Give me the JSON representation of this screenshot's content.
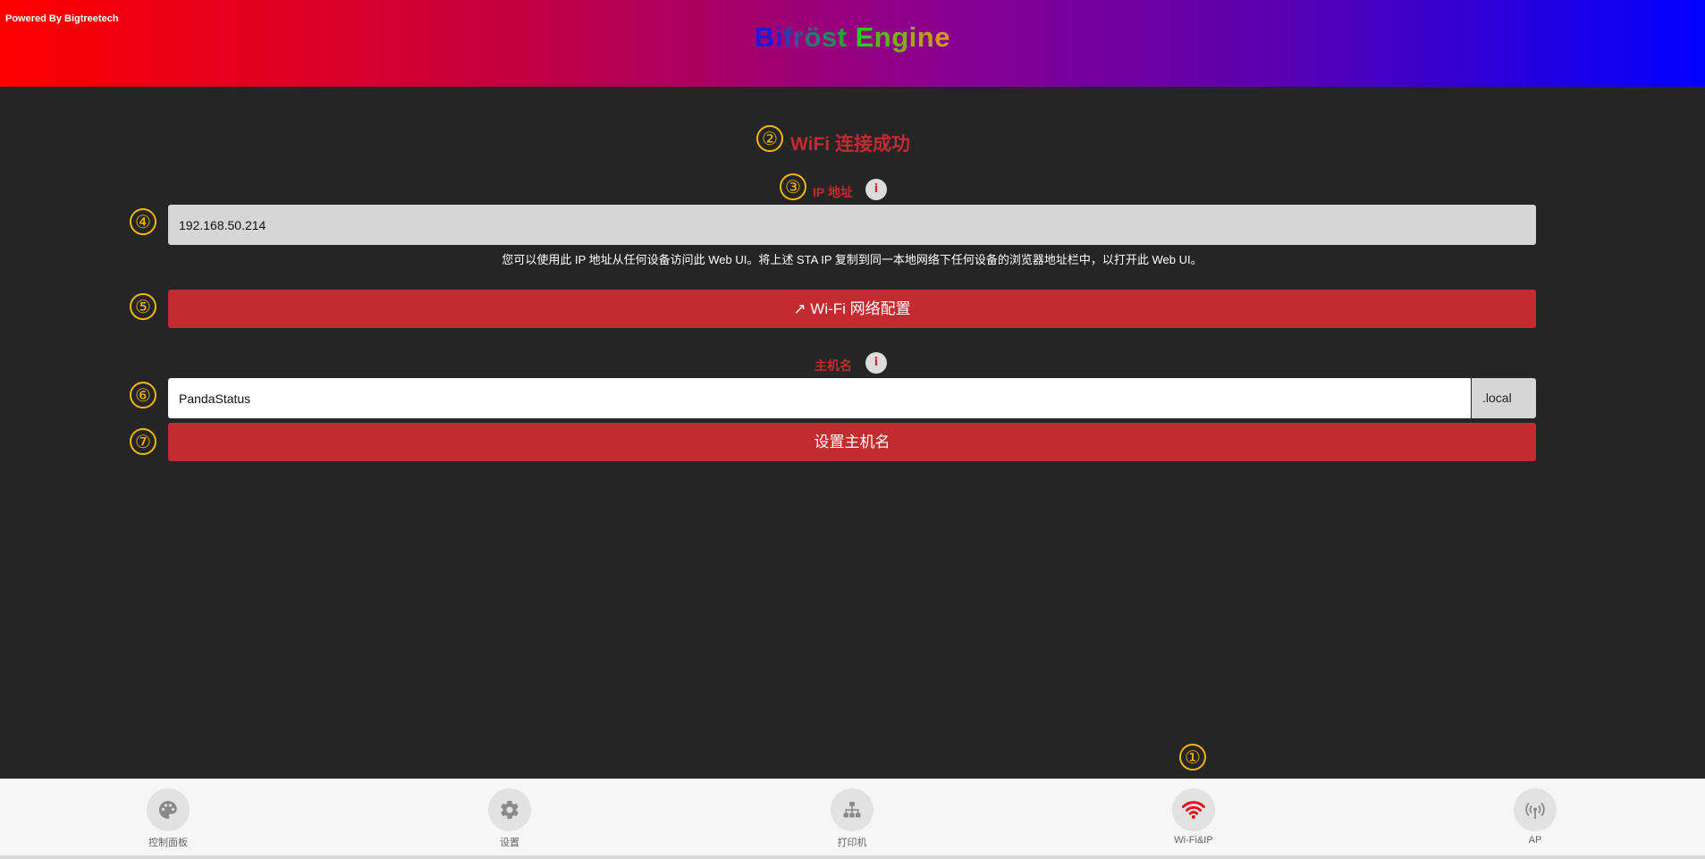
{
  "header": {
    "powered_by": "Powered By Bigtreetech",
    "brand_chars": [
      {
        "ch": "B",
        "color": "#1a1adc"
      },
      {
        "ch": "i",
        "color": "#2a20c8"
      },
      {
        "ch": "f",
        "color": "#2f3cb0"
      },
      {
        "ch": "r",
        "color": "#2d5898"
      },
      {
        "ch": "ö",
        "color": "#2d7478"
      },
      {
        "ch": "s",
        "color": "#2b8a5c"
      },
      {
        "ch": "t",
        "color": "#28a040"
      },
      {
        "ch": " ",
        "color": "#28a040"
      },
      {
        "ch": "E",
        "color": "#2ec81e"
      },
      {
        "ch": "n",
        "color": "#5ab81c"
      },
      {
        "ch": "g",
        "color": "#7cb01a"
      },
      {
        "ch": "i",
        "color": "#a0a81a"
      },
      {
        "ch": "n",
        "color": "#b8a01a"
      },
      {
        "ch": "e",
        "color": "#d09a1a"
      }
    ]
  },
  "annotations": {
    "n1": "①",
    "n2": "②",
    "n3": "③",
    "n4": "④",
    "n5": "⑤",
    "n6": "⑥",
    "n7": "⑦"
  },
  "main": {
    "status_title": "WiFi 连接成功",
    "ip_label": "IP 地址",
    "info_glyph": "i",
    "ip_value": "192.168.50.214",
    "ip_help": "您可以使用此 IP 地址从任何设备访问此 Web UI。将上述 STA IP 复制到同一本地网络下任何设备的浏览器地址栏中，以打开此 Web UI。",
    "wifi_config_button": "↗  Wi-Fi 网络配置",
    "hostname_label": "主机名",
    "hostname_value": "PandaStatus",
    "hostname_suffix": ".local",
    "set_hostname_button": "设置主机名"
  },
  "nav": {
    "items": [
      {
        "label": "控制面板",
        "icon": "palette-icon"
      },
      {
        "label": "设置",
        "icon": "gear-icon"
      },
      {
        "label": "打印机",
        "icon": "sitemap-icon"
      },
      {
        "label": "Wi-Fi&IP",
        "icon": "wifi-icon",
        "active": true
      },
      {
        "label": "AP",
        "icon": "antenna-icon"
      }
    ]
  },
  "colors": {
    "accent_red": "#c22b2f",
    "annotation": "#f5b800",
    "background": "#262526"
  }
}
